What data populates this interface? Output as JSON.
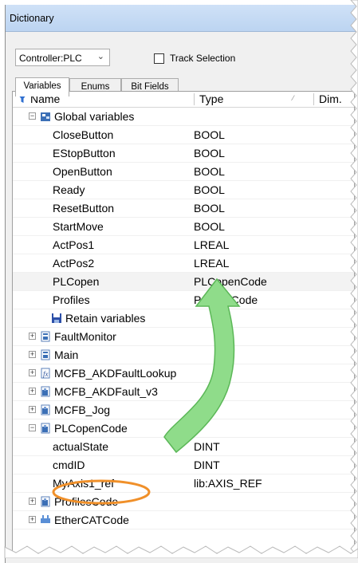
{
  "window": {
    "title": "Dictionary"
  },
  "toolbar": {
    "controller_value": "Controller:PLC",
    "track_selection_label": "Track Selection",
    "track_selection_checked": false
  },
  "tabs": [
    {
      "label": "Variables",
      "active": true
    },
    {
      "label": "Enums",
      "active": false
    },
    {
      "label": "Bit Fields",
      "active": false
    }
  ],
  "columns": {
    "name": "Name",
    "type": "Type",
    "dim": "Dim."
  },
  "rows": [
    {
      "name": "Global variables",
      "type": "",
      "kind": "group-open",
      "icon": "global-variables-icon"
    },
    {
      "name": "CloseButton",
      "type": "BOOL"
    },
    {
      "name": "EStopButton",
      "type": "BOOL"
    },
    {
      "name": "OpenButton",
      "type": "BOOL"
    },
    {
      "name": "Ready",
      "type": "BOOL"
    },
    {
      "name": "ResetButton",
      "type": "BOOL"
    },
    {
      "name": "StartMove",
      "type": "BOOL"
    },
    {
      "name": "ActPos1",
      "type": "LREAL"
    },
    {
      "name": "ActPos2",
      "type": "LREAL"
    },
    {
      "name": "PLCopen",
      "type": "PLCopenCode",
      "selected": true
    },
    {
      "name": "Profiles",
      "type": "ProfilesCode"
    },
    {
      "name": "Retain variables",
      "type": "",
      "kind": "group-none",
      "icon": "save-disk-icon"
    },
    {
      "name": "FaultMonitor",
      "type": "",
      "kind": "group-closed",
      "icon": "program-icon"
    },
    {
      "name": "Main",
      "type": "",
      "kind": "group-closed",
      "icon": "program-icon"
    },
    {
      "name": "MCFB_AKDFaultLookup",
      "type": "",
      "kind": "group-closed",
      "icon": "function-icon"
    },
    {
      "name": "MCFB_AKDFault_v3",
      "type": "",
      "kind": "group-closed",
      "icon": "function-block-icon"
    },
    {
      "name": "MCFB_Jog",
      "type": "",
      "kind": "group-closed",
      "icon": "function-block-icon"
    },
    {
      "name": "PLCopenCode",
      "type": "",
      "kind": "group-open",
      "icon": "function-block-icon"
    },
    {
      "name": "actualState",
      "type": "DINT"
    },
    {
      "name": "cmdID",
      "type": "DINT"
    },
    {
      "name": "MyAxis1_ref",
      "type": "lib:AXIS_REF"
    },
    {
      "name": "ProfilesCode",
      "type": "",
      "kind": "group-closed",
      "icon": "function-block-icon"
    },
    {
      "name": "EtherCATCode",
      "type": "",
      "kind": "group-closed",
      "icon": "ethercat-icon"
    }
  ],
  "annotations": {
    "arrow_color": "#7ed17a",
    "highlight_color": "#f0902a"
  },
  "colors": {
    "titlebar": "#c4d9f3",
    "filter": "#2f6fd0"
  }
}
